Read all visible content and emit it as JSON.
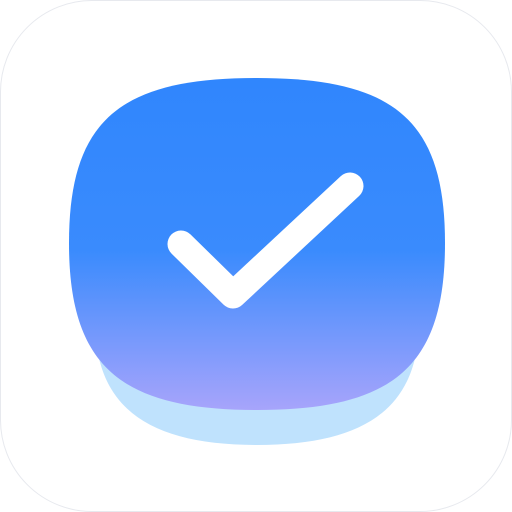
{
  "icon": {
    "name": "check-circle-icon",
    "colors": {
      "tile_background": "#ffffff",
      "tile_border": "#e7e9ee",
      "shadow_base": "#bfe2fd",
      "blob_top": "#3086fd",
      "blob_mid": "#3a8bfd",
      "blob_bottom": "#a7a4fb",
      "checkmark": "#ffffff"
    }
  }
}
